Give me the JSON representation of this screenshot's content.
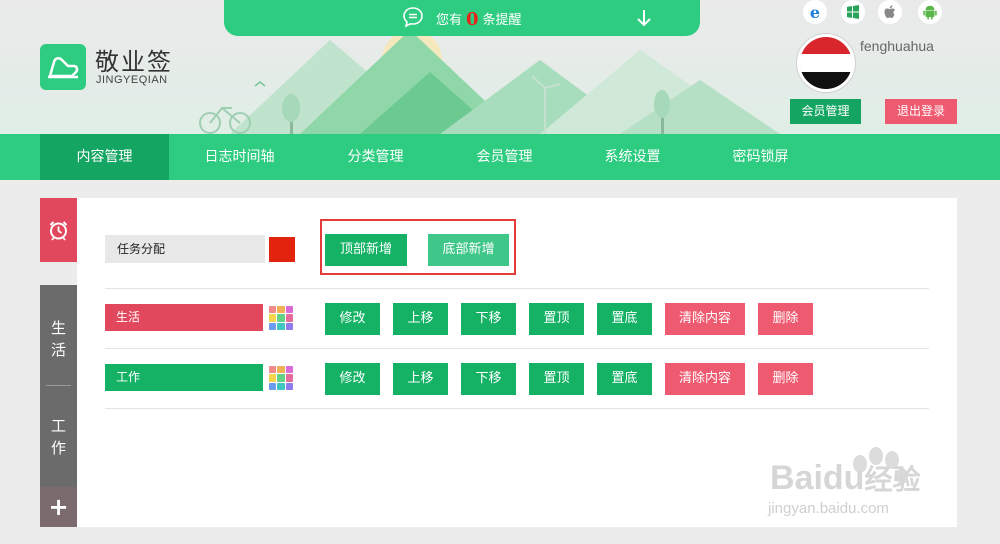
{
  "notification": {
    "prefix": "您有",
    "count": "0",
    "suffix": "条提醒"
  },
  "logo": {
    "title": "敬业签",
    "subtitle": "JINGYEQIAN"
  },
  "os_icons": [
    "ie-icon",
    "windows-icon",
    "apple-icon",
    "android-icon"
  ],
  "user": {
    "name": "fenghuahua",
    "member_btn": "会员管理",
    "logout_btn": "退出登录"
  },
  "nav": {
    "items": [
      {
        "label": "内容管理",
        "active": true
      },
      {
        "label": "日志时间轴"
      },
      {
        "label": "分类管理"
      },
      {
        "label": "会员管理"
      },
      {
        "label": "系统设置"
      },
      {
        "label": "密码锁屏"
      }
    ]
  },
  "sidebar": {
    "categories": [
      "生活",
      "工作"
    ],
    "add": "+"
  },
  "task": {
    "label": "任务分配",
    "color": "#e2230d",
    "top_add": "顶部新增",
    "bottom_add": "底部新增"
  },
  "rows": [
    {
      "label": "生活",
      "color": "#e2485d"
    },
    {
      "label": "工作",
      "color": "#15b266"
    }
  ],
  "actions": {
    "edit": "修改",
    "up": "上移",
    "down": "下移",
    "top": "置顶",
    "bottom": "置底",
    "clear": "清除内容",
    "delete": "删除"
  },
  "watermark": {
    "brand": "Baidu",
    "cn": "经验",
    "url": "jingyan.baidu.com"
  },
  "colors": {
    "primary": "#2ecc80",
    "dark_green": "#15a562",
    "pink": "#ee5a70",
    "red": "#e2485d"
  }
}
